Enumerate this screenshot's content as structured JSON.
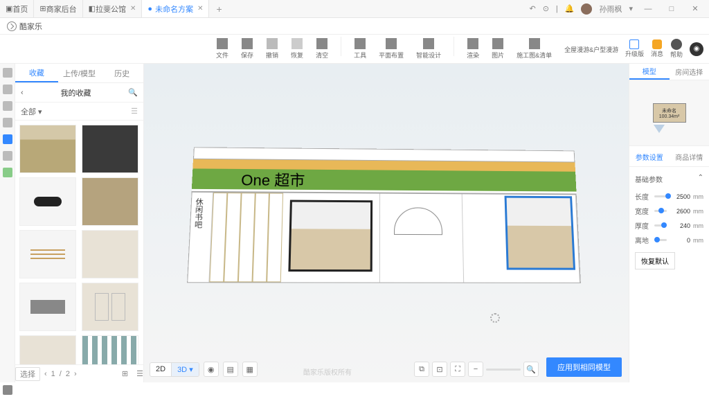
{
  "titlebar": {
    "tabs": [
      {
        "icon": "home",
        "label": "首页"
      },
      {
        "icon": "grid",
        "label": "商家后台"
      },
      {
        "icon": "cube",
        "label": "拉斐公馆"
      }
    ],
    "active_tab": {
      "label": "未命名方案",
      "dot": "●"
    },
    "newtab": "+",
    "right": {
      "undo": "↶",
      "help": "?",
      "sep": "|",
      "user_icon": "🔔",
      "username": "孙雨枫"
    },
    "window": {
      "min": "—",
      "max": "□",
      "close": "✕"
    }
  },
  "appbar": {
    "brand": "酷家乐"
  },
  "toolbar": {
    "items": [
      {
        "icon": "file",
        "label": "文件"
      },
      {
        "icon": "save",
        "label": "保存"
      },
      {
        "icon": "undo",
        "label": "撤销"
      },
      {
        "icon": "redo",
        "label": "恢复"
      },
      {
        "icon": "clear",
        "label": "清空"
      },
      {
        "icon": "tool",
        "label": "工具"
      },
      {
        "icon": "plan",
        "label": "平面布置"
      },
      {
        "icon": "smart",
        "label": "智能设计"
      },
      {
        "icon": "camera",
        "label": "渲染"
      },
      {
        "icon": "img",
        "label": "图片"
      },
      {
        "icon": "list",
        "label": "施工图&清单"
      },
      {
        "icon": "vr",
        "label": "全屋漫游&户型漫游"
      }
    ],
    "right": [
      {
        "label": "升级版"
      },
      {
        "label": "消息"
      },
      {
        "label": "帮助"
      }
    ]
  },
  "rail": {
    "icons": [
      "home",
      "light",
      "box",
      "door",
      "person",
      "layers",
      "leaf"
    ]
  },
  "left_panel": {
    "tabs": [
      "收藏",
      "上传/模型",
      "历史"
    ],
    "active_tab": 0,
    "title": "我的收藏",
    "filter": "全部",
    "page_current": "1",
    "page_total": "2",
    "page_sep": "/"
  },
  "scene": {
    "sign": "One 超市",
    "vertical_text": "休闲书吧"
  },
  "minimap": {
    "room_label": "未命名",
    "room_area": "100.34m²"
  },
  "right_panel": {
    "view_tabs": [
      "模型",
      "房间选择"
    ],
    "prop_tabs": [
      "参数设置",
      "商品详情"
    ],
    "section_title": "基础参数",
    "params": [
      {
        "label": "长度",
        "value": "2500",
        "unit": "mm",
        "pos": 90
      },
      {
        "label": "宽度",
        "value": "2600",
        "unit": "mm",
        "pos": 35
      },
      {
        "label": "厚度",
        "value": "240",
        "unit": "mm",
        "pos": 55
      },
      {
        "label": "离地",
        "value": "0",
        "unit": "mm",
        "pos": 0
      }
    ],
    "reset": "恢复默认",
    "apply": "应用到相同模型"
  },
  "viewbar": {
    "mode_2d": "2D",
    "mode_3d": "3D",
    "arrow": "▾",
    "filter_label": "选择"
  },
  "watermark": "酷家乐版权所有"
}
